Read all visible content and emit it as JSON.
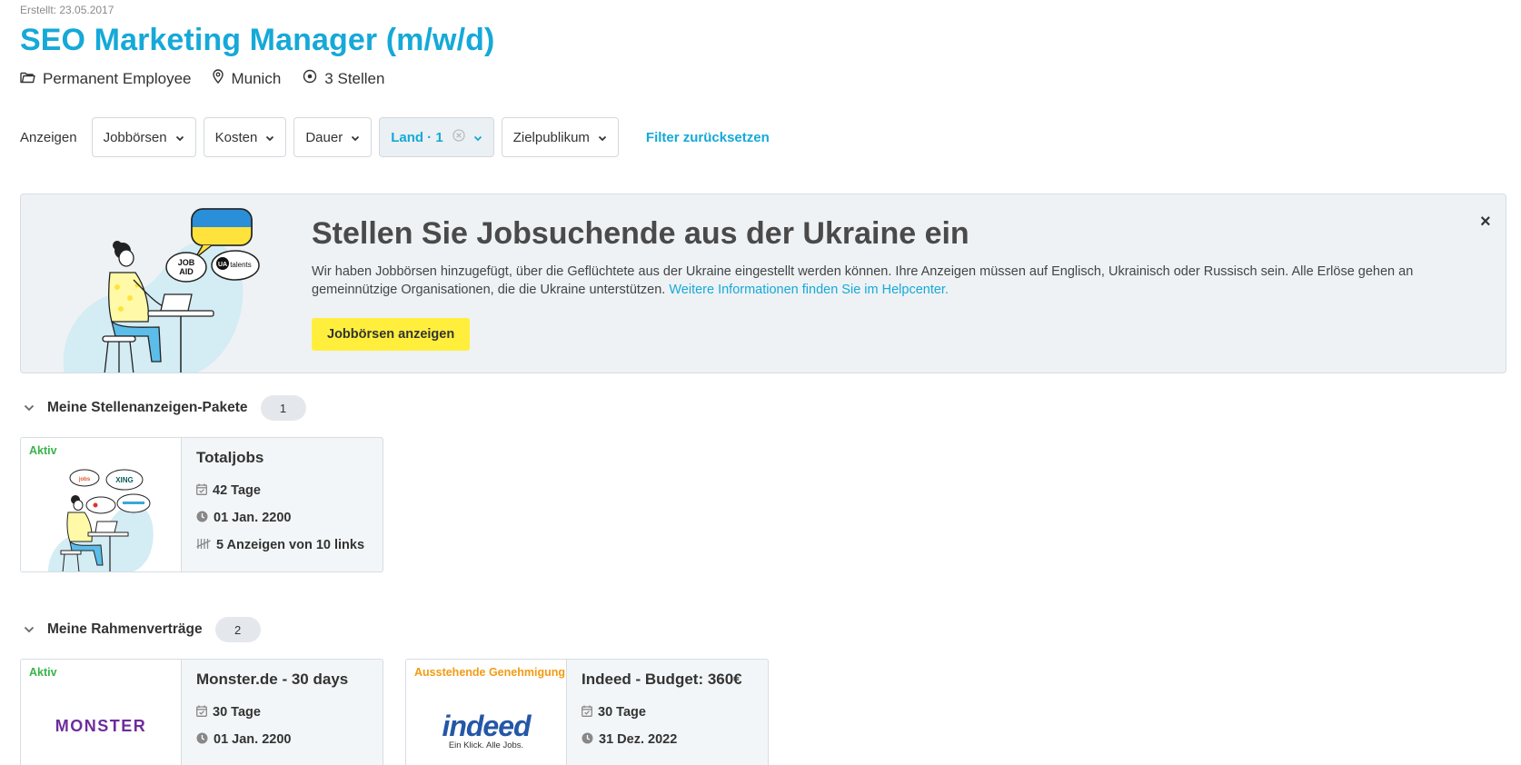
{
  "header": {
    "created": "Erstellt: 23.05.2017",
    "title": "SEO Marketing Manager (m/w/d)",
    "employment_type": "Permanent Employee",
    "location": "Munich",
    "positions": "3 Stellen"
  },
  "filters": {
    "label": "Anzeigen",
    "items": [
      "Jobbörsen",
      "Kosten",
      "Dauer",
      "Land · 1",
      "Zielpublikum"
    ],
    "reset": "Filter zurücksetzen",
    "accent": "#15a9d8"
  },
  "banner": {
    "title": "Stellen Sie Jobsuchende aus der Ukraine ein",
    "text": "Wir haben Jobbörsen hinzugefügt, über die Geflüchtete aus der Ukraine eingestellt werden können. Ihre Anzeigen müssen auf Englisch, Ukrainisch oder Russisch sein. Alle Erlöse gehen an gemeinnützige Organisationen, die die Ukraine unterstützen.",
    "link": "Weitere Informationen finden Sie im Helpcenter.",
    "button": "Jobbörsen anzeigen",
    "close": "×",
    "illustration_labels": {
      "jobaid_line1": "JOB",
      "jobaid_line2": "AID",
      "ua": "UA",
      "talents": "talents"
    }
  },
  "packages": {
    "title": "Meine Stellenanzeigen-Pakete",
    "count": "1",
    "cards": [
      {
        "status": "Aktiv",
        "title": "Totaljobs",
        "duration": "42 Tage",
        "date": "01 Jan. 2200",
        "quota": "5 Anzeigen von 10 links",
        "illustration_labels": {
          "xing": "XING"
        }
      }
    ]
  },
  "contracts": {
    "title": "Meine Rahmenverträge",
    "count": "2",
    "cards": [
      {
        "status": "Aktiv",
        "title": "Monster.de - 30 days",
        "duration": "30 Tage",
        "date": "01 Jan. 2200",
        "logo_text": "MONSTER"
      },
      {
        "status": "Ausstehende Genehmigung",
        "title": "Indeed - Budget: 360€",
        "duration": "30 Tage",
        "date": "31 Dez. 2022",
        "logo_text": "indeed",
        "logo_tagline": "Ein Klick. Alle Jobs."
      }
    ]
  }
}
